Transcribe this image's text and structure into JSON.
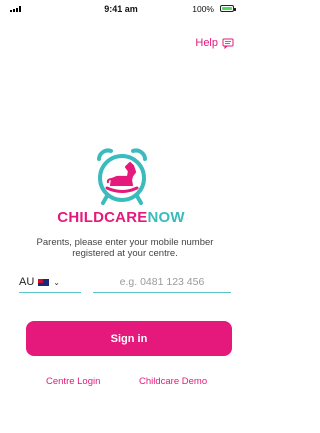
{
  "status_bar": {
    "time": "9:41 am",
    "battery": "100%"
  },
  "help": {
    "label": "Help"
  },
  "brand": {
    "part1": "CHILDCARE",
    "part2": "NOW"
  },
  "login": {
    "instructions": "Parents, please enter your mobile number registered at your centre.",
    "country_code": "AU",
    "phone_placeholder": "e.g. 0481 123 456",
    "signin_label": "Sign in"
  },
  "links": {
    "centre_login": "Centre Login",
    "childcare_demo": "Childcare Demo"
  },
  "colors": {
    "accent": "#e5197c",
    "teal": "#3bbbbd"
  }
}
